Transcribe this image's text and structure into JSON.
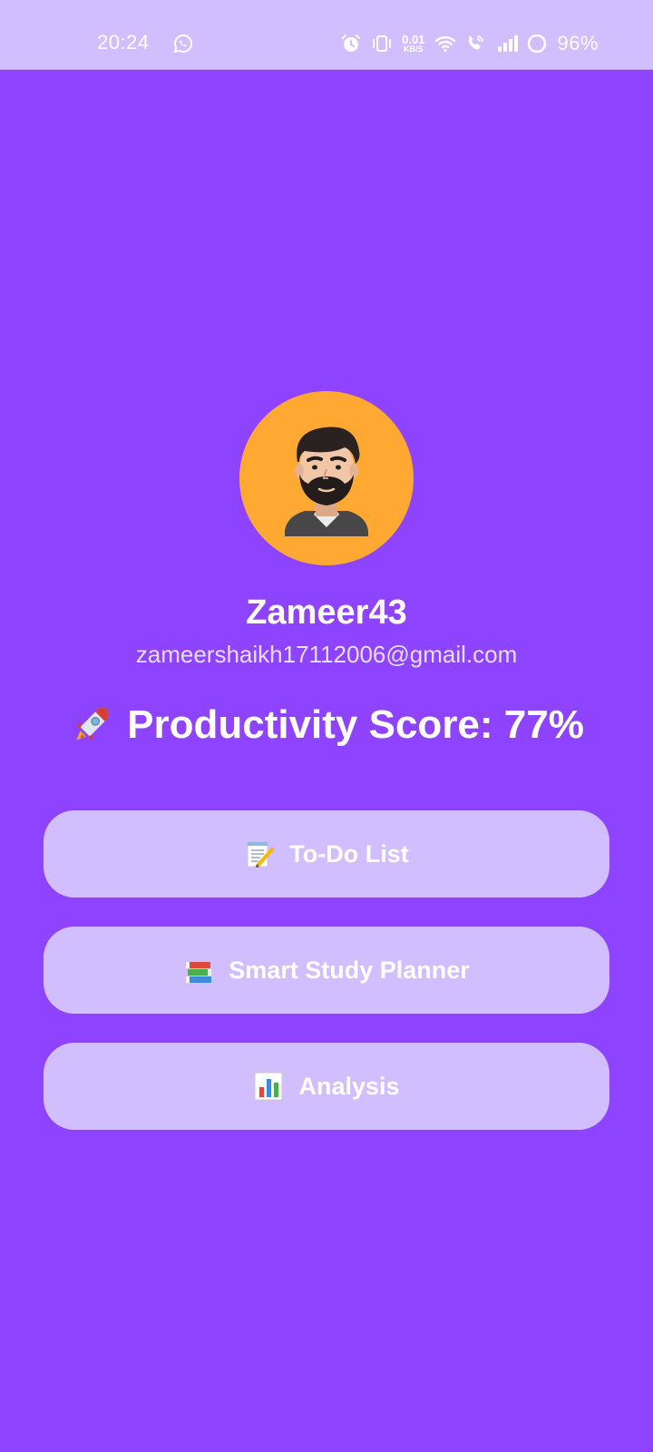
{
  "status_bar": {
    "time": "20:24",
    "net_speed_value": "0.01",
    "net_speed_unit": "KB/S",
    "battery": "96%",
    "icons": [
      "whatsapp-icon",
      "alarm-icon",
      "vibrate-icon",
      "wifi-icon",
      "wifi-call-icon",
      "signal-icon",
      "battery-icon"
    ]
  },
  "profile": {
    "avatar": "avatar-man-beard",
    "username": "Zameer43",
    "email": "zameershaikh17112006@gmail.com"
  },
  "score": {
    "icon": "rocket-icon",
    "text": "Productivity Score: 77%"
  },
  "menu": [
    {
      "icon": "memo-icon",
      "label": "To-Do List"
    },
    {
      "icon": "books-icon",
      "label": "Smart Study Planner"
    },
    {
      "icon": "bar-chart-icon",
      "label": "Analysis"
    }
  ],
  "colors": {
    "background": "#8E44FF",
    "status_bar": "#D1BEFF",
    "button": "#D1BEFF",
    "avatar_bg": "#FFA933"
  }
}
